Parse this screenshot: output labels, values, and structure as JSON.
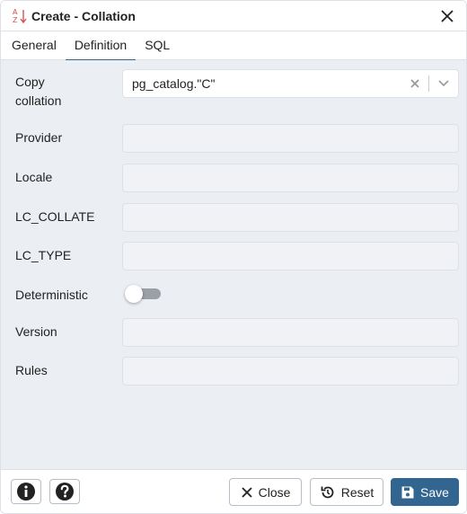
{
  "dialog": {
    "title": "Create - Collation",
    "icon": "collation-sort-icon",
    "close_icon": "close-icon"
  },
  "tabs": [
    {
      "label": "General",
      "active": false
    },
    {
      "label": "Definition",
      "active": true
    },
    {
      "label": "SQL",
      "active": false
    }
  ],
  "form": {
    "copy_collation": {
      "label": "Copy collation",
      "value": "pg_catalog.\"C\""
    },
    "provider": {
      "label": "Provider",
      "value": ""
    },
    "locale": {
      "label": "Locale",
      "value": ""
    },
    "lc_collate": {
      "label": "LC_COLLATE",
      "value": ""
    },
    "lc_type": {
      "label": "LC_TYPE",
      "value": ""
    },
    "deterministic": {
      "label": "Deterministic",
      "checked": false
    },
    "version": {
      "label": "Version",
      "value": ""
    },
    "rules": {
      "label": "Rules",
      "value": ""
    }
  },
  "footer": {
    "info_icon": "info-icon",
    "help_icon": "help-icon",
    "close_label": "Close",
    "reset_label": "Reset",
    "save_label": "Save"
  },
  "colors": {
    "accent": "#326690",
    "panel_bg": "#ebeef3",
    "field_bg": "#f0f2f5",
    "title_icon": "#d9534f"
  }
}
